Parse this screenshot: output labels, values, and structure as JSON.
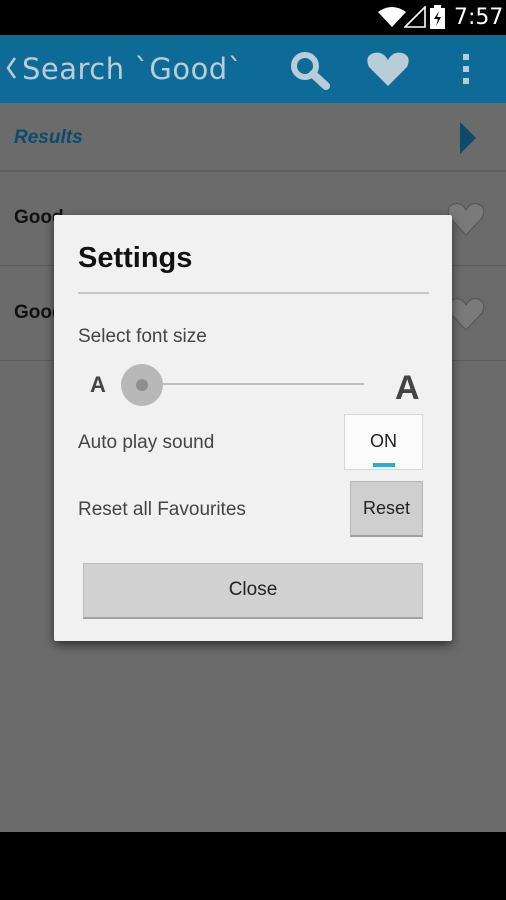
{
  "status_bar": {
    "time": "7:57"
  },
  "app_bar": {
    "title": "Search `Good`",
    "actions": [
      "search-icon",
      "heart-icon",
      "overflow-menu-icon"
    ]
  },
  "results_header": {
    "label": "Results"
  },
  "rows": [
    {
      "word": "Good"
    },
    {
      "word": "Good"
    }
  ],
  "dialog": {
    "title": "Settings",
    "font_size": {
      "label": "Select font size",
      "min_label": "A",
      "max_label": "A",
      "value": 0
    },
    "auto_play": {
      "label": "Auto play sound",
      "toggle": "ON"
    },
    "reset": {
      "label": "Reset all Favourites",
      "button": "Reset"
    },
    "close_button": "Close"
  },
  "colors": {
    "app_bar": "#0e6b97",
    "toggle_accent": "#35a7d9",
    "results_label": "#0d4a6c"
  }
}
